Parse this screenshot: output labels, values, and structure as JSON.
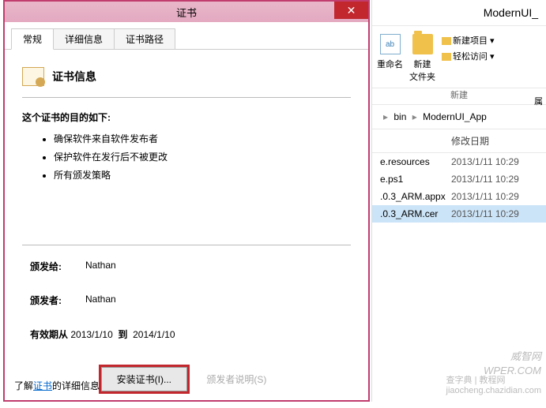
{
  "dialog": {
    "title": "证书",
    "tabs": [
      "常规",
      "详细信息",
      "证书路径"
    ],
    "cert_info_heading": "证书信息",
    "purpose_heading": "这个证书的目的如下:",
    "purposes": [
      "确保软件来自软件发布者",
      "保护软件在发行后不被更改",
      "所有颁发策略"
    ],
    "issued_to_label": "颁发给:",
    "issued_to_value": "Nathan",
    "issued_by_label": "颁发者:",
    "issued_by_value": "Nathan",
    "valid_from_label": "有效期从",
    "valid_from": "2013/1/10",
    "valid_to_label": "到",
    "valid_to": "2014/1/10",
    "install_btn": "安装证书(I)...",
    "issuer_btn": "颁发者说明(S)",
    "learn_prefix": "了解",
    "learn_link": "证书",
    "learn_suffix": "的详细信息"
  },
  "explorer": {
    "window_title": "ModernUI_",
    "rename": "重命名",
    "newfolder": "新建\n文件夹",
    "new_item": "新建项目 ▾",
    "easy_access": "轻松访问 ▾",
    "group_label": "新建",
    "extra": "属",
    "breadcrumb": {
      "sep": "▸",
      "p1": "bin",
      "p2": "ModernUI_App"
    },
    "col_date": "修改日期",
    "files": [
      {
        "name": "e.resources",
        "date": "2013/1/11 10:29"
      },
      {
        "name": "e.ps1",
        "date": "2013/1/11 10:29"
      },
      {
        "name": ".0.3_ARM.appx",
        "date": "2013/1/11 10:29"
      },
      {
        "name": ".0.3_ARM.cer",
        "date": "2013/1/11 10:29",
        "selected": true
      }
    ]
  },
  "watermark": {
    "line1": "威智网",
    "line2": "WPER.COM",
    "line3": "查字典 | 教程网",
    "line4": "jiaocheng.chazidian.com"
  }
}
